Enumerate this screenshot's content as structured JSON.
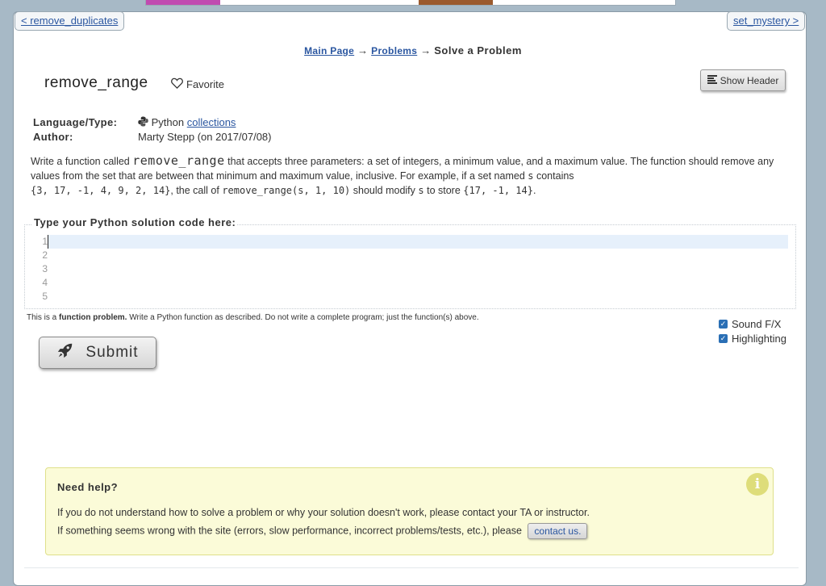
{
  "nav": {
    "prev_label": "< remove_duplicates",
    "next_label": "set_mystery >"
  },
  "breadcrumb": {
    "main": "Main Page",
    "problems": "Problems",
    "arrow": "→",
    "current": "Solve a Problem"
  },
  "problem": {
    "title": "remove_range",
    "favorite_label": "Favorite",
    "show_header_label": "Show Header",
    "language_label": "Language/Type:",
    "language_value": "Python",
    "language_link": "collections",
    "author_label": "Author:",
    "author_value": "Marty Stepp (on 2017/07/08)"
  },
  "description": {
    "p1": "Write a function called",
    "fn_name": "remove_range",
    "p2": "that accepts three parameters: a set of integers, a minimum value, and a maximum value. The function should remove any values from the set that are between that minimum and maximum value, inclusive. For example, if a set named",
    "var_s": "s",
    "p3": "contains",
    "set_before": "{3, 17, -1, 4, 9, 2, 14}",
    "p4": ", the call of",
    "call": "remove_range(s, 1, 10)",
    "p5": "should modify",
    "var_s2": "s",
    "p6": "to store",
    "set_after": "{17, -1, 14}",
    "p7": "."
  },
  "code": {
    "legend": "Type your Python solution code here:",
    "line_numbers": [
      "1",
      "2",
      "3",
      "4",
      "5"
    ]
  },
  "note": {
    "prefix": "This is a",
    "bold": "function problem.",
    "suffix": "Write a Python function as described. Do not write a complete program; just the function(s) above."
  },
  "options": {
    "sound_label": "Sound F/X",
    "highlight_label": "Highlighting"
  },
  "submit_label": "Submit",
  "help": {
    "title": "Need help?",
    "line1": "If you do not understand how to solve a problem or why your solution doesn't work, please contact your TA or instructor.",
    "line2": "If something seems wrong with the site (errors, slow performance, incorrect problems/tests, etc.), please",
    "contact_label": "contact us."
  }
}
